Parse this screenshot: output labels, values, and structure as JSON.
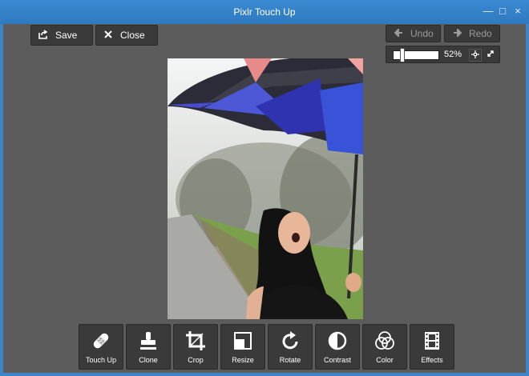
{
  "window": {
    "title": "Pixlr Touch Up",
    "minimize_label": "—",
    "maximize_label": "□",
    "close_label": "×"
  },
  "toolbar_top": {
    "save_label": "Save",
    "close_label": "Close",
    "undo_label": "Undo",
    "redo_label": "Redo"
  },
  "zoom": {
    "value_label": "52%",
    "level": 0.16
  },
  "tools": [
    {
      "label": "Touch Up",
      "icon": "bandage-icon"
    },
    {
      "label": "Clone",
      "icon": "stamp-icon"
    },
    {
      "label": "Crop",
      "icon": "crop-icon"
    },
    {
      "label": "Resize",
      "icon": "resize-icon"
    },
    {
      "label": "Rotate",
      "icon": "rotate-icon"
    },
    {
      "label": "Contrast",
      "icon": "contrast-icon"
    },
    {
      "label": "Color",
      "icon": "color-circles-icon"
    },
    {
      "label": "Effects",
      "icon": "film-icon"
    }
  ],
  "colors": {
    "titlebar": "#3b8ad2",
    "panel": "#5c5c5c",
    "button": "#3a3a3a"
  }
}
